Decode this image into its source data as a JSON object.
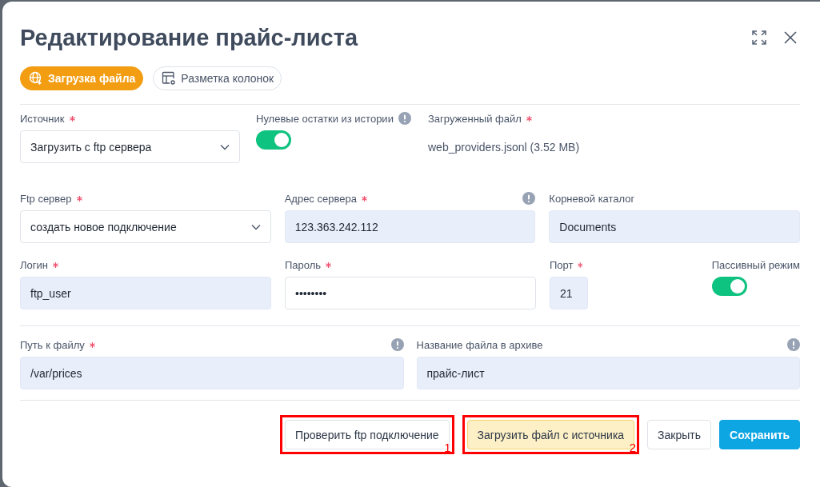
{
  "dialog": {
    "title": "Редактирование прайс-листа",
    "tabs": [
      {
        "label": "Загрузка файла",
        "selected": true
      },
      {
        "label": "Разметка колонок",
        "selected": false
      }
    ],
    "rows": [
      [
        {
          "kind": "select",
          "label": "Источник",
          "required": true,
          "info": false,
          "value": "Загрузить с ftp сервера"
        },
        {
          "kind": "toggle",
          "label": "Нулевые остатки из истории",
          "required": false,
          "info": true,
          "on": true
        },
        {
          "kind": "file",
          "label": "Загруженный файл",
          "required": true,
          "info": false,
          "value": "web_providers.jsonl (3.52 MB)"
        }
      ],
      [
        {
          "kind": "select",
          "label": "Ftp сервер",
          "required": true,
          "info": false,
          "value": "создать новое подключение"
        },
        {
          "kind": "input",
          "label": "Адрес сервера",
          "required": true,
          "info": true,
          "filled": true,
          "value": "123.363.242.112"
        },
        {
          "kind": "input",
          "label": "Корневой каталог",
          "required": false,
          "info": false,
          "filled": true,
          "value": "Documents"
        }
      ],
      [
        {
          "kind": "input",
          "label": "Логин",
          "required": true,
          "info": false,
          "filled": true,
          "value": "ftp_user"
        },
        {
          "kind": "input",
          "label": "Пароль",
          "required": true,
          "info": false,
          "filled": false,
          "value": "••••••••"
        },
        {
          "kind": "input",
          "label": "Порт",
          "required": true,
          "info": false,
          "filled": true,
          "value": "21"
        },
        {
          "kind": "toggle",
          "label": "Пассивный режим",
          "required": false,
          "info": false,
          "on": true
        }
      ],
      [
        {
          "kind": "input",
          "label": "Путь к файлу",
          "required": true,
          "info": true,
          "filled": true,
          "value": "/var/prices"
        },
        {
          "kind": "input",
          "label": "Название файла в архиве",
          "required": false,
          "info": true,
          "filled": true,
          "value": "прайс-лист"
        }
      ]
    ],
    "buttons": [
      {
        "label": "Проверить ftp подключение",
        "kind": "default",
        "callout": "1"
      },
      {
        "label": "Загрузить файл с источника",
        "kind": "warning",
        "callout": "2"
      },
      {
        "label": "Закрыть",
        "kind": "default"
      },
      {
        "label": "Сохранить",
        "kind": "primary"
      }
    ]
  }
}
